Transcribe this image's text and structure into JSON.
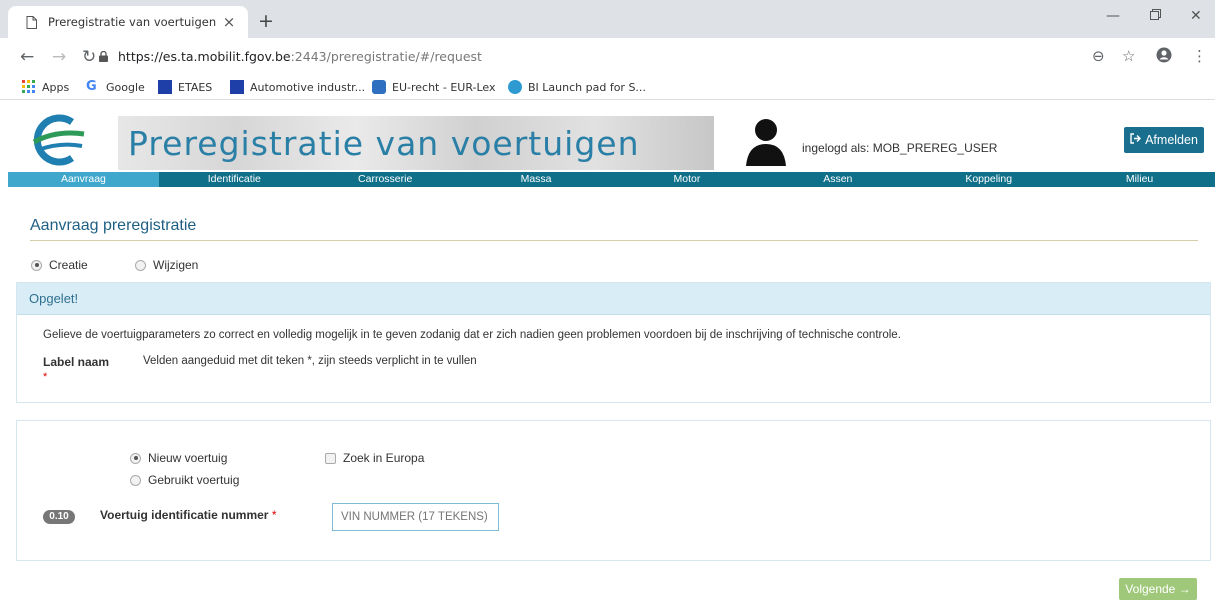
{
  "browser": {
    "tab_title": "Preregistratie van voertuigen",
    "tab_close": "×",
    "new_tab": "+",
    "url_host": "https://es.ta.mobilit.fgov.be",
    "url_rest": ":2443/preregistratie/#/request",
    "bookmarks": [
      {
        "label": "Apps",
        "icon": "apps-grid-icon"
      },
      {
        "label": "Google",
        "icon": "google-icon"
      },
      {
        "label": "ETAES",
        "icon": "eu-flag-icon"
      },
      {
        "label": "Automotive industr...",
        "icon": "eu-flag-icon"
      },
      {
        "label": "EU-recht - EUR-Lex",
        "icon": "eurlex-icon"
      },
      {
        "label": "BI Launch pad for S...",
        "icon": "bi-launchpad-icon"
      }
    ]
  },
  "header": {
    "title": "Preregistratie van voertuigen",
    "user_label": "ingelogd als: MOB_PREREG_USER",
    "logout_label": "Afmelden"
  },
  "nav": {
    "items": [
      "Aanvraag",
      "Identificatie",
      "Carrosserie",
      "Massa",
      "Motor",
      "Assen",
      "Koppeling",
      "Milieu"
    ],
    "active_index": 0
  },
  "main": {
    "title": "Aanvraag preregistratie",
    "mode_options": [
      {
        "label": "Creatie",
        "selected": true
      },
      {
        "label": "Wijzigen",
        "selected": false
      }
    ],
    "alert": {
      "heading": "Opgelet!",
      "text": "Gelieve de voertuigparameters zo correct en volledig mogelijk in te geven zodanig dat er zich nadien geen problemen voordoen bij de inschrijving of technische controle.",
      "label_name": "Label naam",
      "label_desc": "Velden aangeduid met dit teken *, zijn steeds verplicht in te vullen",
      "required_mark": "*"
    },
    "form": {
      "vehicle_new": "Nieuw voertuig",
      "vehicle_used": "Gebruikt voertuig",
      "search_europe": "Zoek in Europa",
      "field_number": "0.10",
      "vin_label": "Voertuig identificatie nummer",
      "vin_required": "*",
      "vin_placeholder": "VIN NUMMER (17 TEKENS)",
      "vin_value": ""
    },
    "next_label": "Volgende →"
  },
  "colors": {
    "nav_bg": "#106f89",
    "nav_active": "#3fa7cc",
    "title_blue": "#1f5f84",
    "alert_bg": "#d9edf7",
    "next_green": "#9fc87a",
    "logout_bg": "#1a6f8e"
  }
}
